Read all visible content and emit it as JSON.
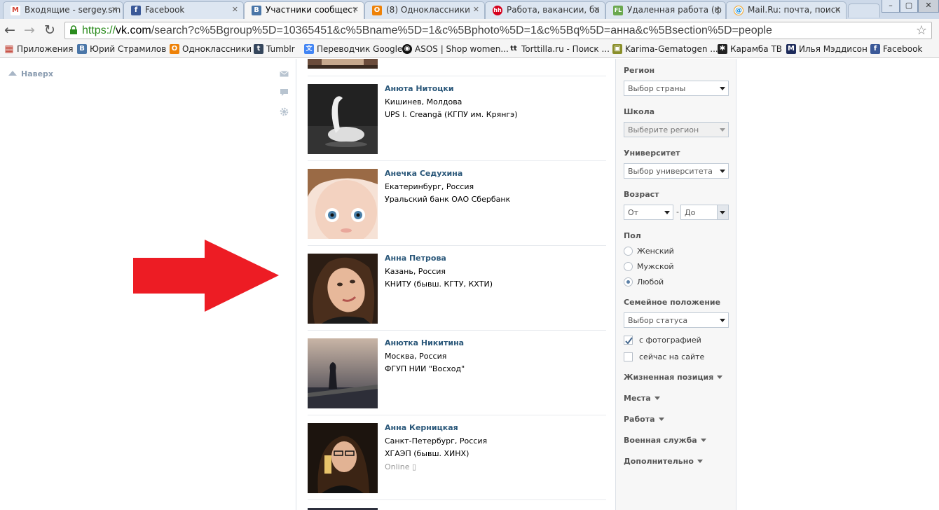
{
  "tabs": [
    {
      "title": "Входящие - sergey.sm",
      "icon": "gmail-icon",
      "color": "#d44638",
      "glyph": "M"
    },
    {
      "title": "Facebook",
      "icon": "facebook-icon",
      "color": "#3b5998",
      "glyph": "f"
    },
    {
      "title": "Участники сообщест",
      "icon": "vk-icon",
      "color": "#4a76a8",
      "glyph": "B"
    },
    {
      "title": "(8) Одноклассники",
      "icon": "odnoklassniki-icon",
      "color": "#ee8208",
      "glyph": "О"
    },
    {
      "title": "Работа, вакансии, ба",
      "icon": "hh-icon",
      "color": "#d6001c",
      "glyph": "hh"
    },
    {
      "title": "Удаленная работа (ф",
      "icon": "fl-icon",
      "color": "#6aa84f",
      "glyph": "FL"
    },
    {
      "title": "Mail.Ru: почта, поиск",
      "icon": "mailru-icon",
      "color": "#168de2",
      "glyph": "@"
    }
  ],
  "window_controls": [
    "–",
    "▢",
    "✕"
  ],
  "address": {
    "scheme": "https://",
    "host": "vk.com",
    "path": "/search?c%5Bgroup%5D=10365451&c%5Bname%5D=1&c%5Bphoto%5D=1&c%5Bq%5D=анна&c%5Bsection%5D=people"
  },
  "bookmarks": [
    {
      "label": "Приложения",
      "icon": "apps-grid-icon",
      "color": "#c0392b",
      "glyph": "▦"
    },
    {
      "label": "Юрий Страмилов",
      "icon": "vk-icon",
      "color": "#4a76a8",
      "glyph": "B"
    },
    {
      "label": "Одноклассники",
      "icon": "odnoklassniki-icon",
      "color": "#ee8208",
      "glyph": "О"
    },
    {
      "label": "Tumblr",
      "icon": "tumblr-icon",
      "color": "#35465c",
      "glyph": "t"
    },
    {
      "label": "Переводчик Google",
      "icon": "google-translate-icon",
      "color": "#4285f4",
      "glyph": "文"
    },
    {
      "label": "ASOS | Shop women...",
      "icon": "asos-icon",
      "color": "#111111",
      "glyph": "◉"
    },
    {
      "label": "Torttilla.ru - Поиск ...",
      "icon": "torttilla-icon",
      "color": "#ffffff",
      "glyph": "tt"
    },
    {
      "label": "Karima-Gematogen ...",
      "icon": "karima-icon",
      "color": "#8a8f2a",
      "glyph": "▣"
    },
    {
      "label": "Карамба ТВ",
      "icon": "karamba-icon",
      "color": "#222222",
      "glyph": "✱"
    },
    {
      "label": "Илья Мэддисон",
      "icon": "maddison-icon",
      "color": "#1d2b5b",
      "glyph": "M"
    },
    {
      "label": "Facebook",
      "icon": "facebook-icon",
      "color": "#3b5998",
      "glyph": "f"
    }
  ],
  "sidebar": {
    "up_label": "Наверх"
  },
  "results": [
    {
      "name": "Анюта Нитоцки",
      "line1": "Кишинев, Молдова",
      "line2": "UPS I. Creangă (КГПУ им. Крянгэ)",
      "line3": ""
    },
    {
      "name": "Анечка Седухина",
      "line1": "Екатеринбург, Россия",
      "line2": "Уральский банк ОАО Сбербанк",
      "line3": ""
    },
    {
      "name": "Анна Петрова",
      "line1": "Казань, Россия",
      "line2": "КНИТУ (бывш. КГТУ, КХТИ)",
      "line3": ""
    },
    {
      "name": "Анютка Никитина",
      "line1": "Москва, Россия",
      "line2": "ФГУП НИИ \"Восход\"",
      "line3": ""
    },
    {
      "name": "Анна Керницкая",
      "line1": "Санкт-Петербург, Россия",
      "line2": "ХГАЭП (бывш. ХИНХ)",
      "line3": "Online"
    }
  ],
  "filters": {
    "region_label": "Регион",
    "region_value": "Выбор страны",
    "school_label": "Школа",
    "school_value": "Выберите регион",
    "university_label": "Университет",
    "university_value": "Выбор университета",
    "age_label": "Возраст",
    "age_from": "От",
    "age_sep": "-",
    "age_to": "До",
    "gender_label": "Пол",
    "gender_options": [
      "Женский",
      "Мужской",
      "Любой"
    ],
    "gender_selected": 2,
    "marital_label": "Семейное положение",
    "marital_value": "Выбор статуса",
    "with_photo": "с фотографией",
    "online_now": "сейчас на сайте",
    "expanders": [
      "Жизненная позиция",
      "Места",
      "Работа",
      "Военная служба",
      "Дополнительно"
    ]
  },
  "colors": {
    "arrow": "#ed1c24",
    "vk_link": "#2b587a"
  }
}
